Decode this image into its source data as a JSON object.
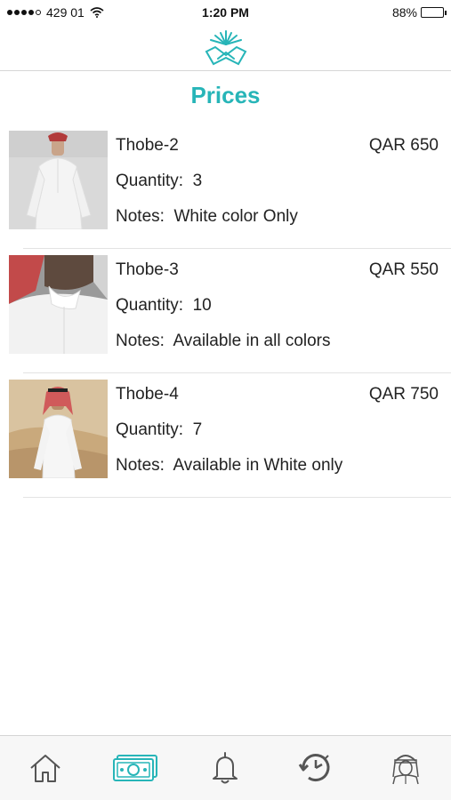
{
  "status": {
    "carrier": "429 01",
    "time": "1:20 PM",
    "battery": "88%",
    "battery_level": 0.88
  },
  "header": {
    "logo_icon": "book-sunburst-logo-icon"
  },
  "page": {
    "title": "Prices"
  },
  "colors": {
    "accent": "#27b5b8",
    "tab_inactive": "#555555"
  },
  "items": [
    {
      "name": "Thobe-2",
      "price": "QAR 650",
      "quantity_label": "Quantity:",
      "quantity": "3",
      "notes_label": "Notes:",
      "notes": "White color Only"
    },
    {
      "name": "Thobe-3",
      "price": "QAR 550",
      "quantity_label": "Quantity:",
      "quantity": "10",
      "notes_label": "Notes:",
      "notes": "Available in all colors"
    },
    {
      "name": "Thobe-4",
      "price": "QAR 750",
      "quantity_label": "Quantity:",
      "quantity": "7",
      "notes_label": "Notes:",
      "notes": "Available in White only"
    }
  ],
  "tabs": [
    {
      "icon": "home-icon",
      "active": false
    },
    {
      "icon": "money-icon",
      "active": true
    },
    {
      "icon": "bell-icon",
      "active": false
    },
    {
      "icon": "history-icon",
      "active": false
    },
    {
      "icon": "profile-icon",
      "active": false
    }
  ]
}
